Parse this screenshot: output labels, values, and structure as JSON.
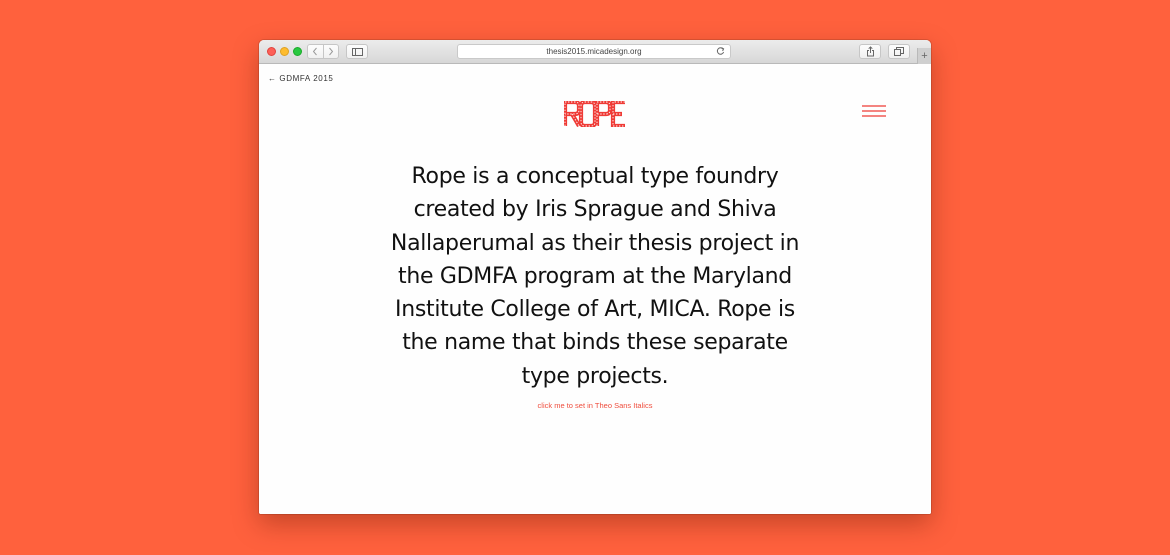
{
  "browser": {
    "url": "thesis2015.micadesign.org",
    "new_tab_glyph": "+"
  },
  "page": {
    "back_link": "← GDMFA 2015",
    "logo_text": "ROPE",
    "intro_text": "Rope is a conceptual type foundry created by Iris Sprague and Shiva Nallaperumal as their thesis project in the GDMFA program at the Maryland Institute College of Art, MICA. Rope is the name that binds these separate type projects.",
    "italics_link": "click me to set in Theo Sans Italics"
  },
  "icons": {
    "menu": "hamburger-menu-icon",
    "back": "chevron-left-icon",
    "forward": "chevron-right-icon",
    "sidebar": "sidebar-icon",
    "reload": "reload-icon",
    "share": "share-icon",
    "tabs": "tabs-icon"
  },
  "colors": {
    "background": "#ff613d",
    "accent": "#ef3b36",
    "link": "#ef4d3d",
    "text": "#111111"
  }
}
